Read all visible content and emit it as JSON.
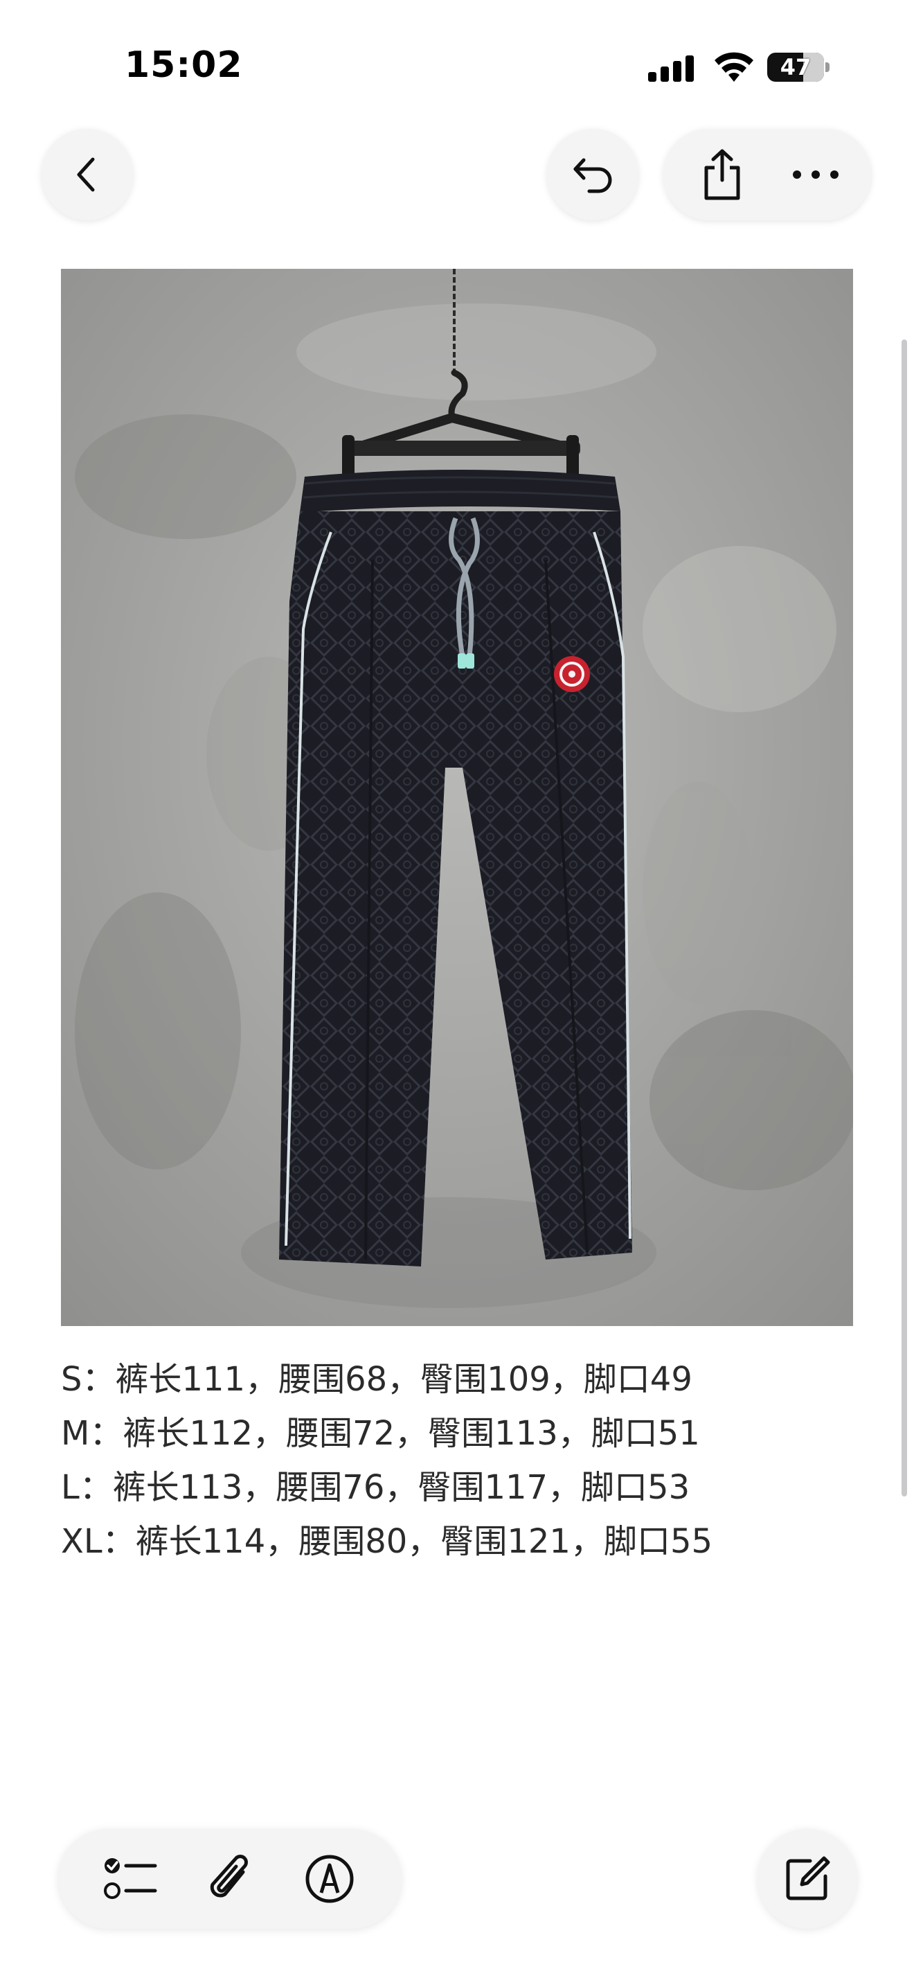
{
  "status_bar": {
    "time": "15:02",
    "battery": "47"
  },
  "nav": {
    "back_icon": "chevron-left-icon",
    "undo_icon": "undo-icon",
    "share_icon": "share-icon",
    "more_icon": "ellipsis-icon"
  },
  "note": {
    "image": "photo of dark patterned track pants hanging on a concrete wall",
    "size_lines": [
      "S：裤长111，腰围68，臀围109，脚口49",
      "M：裤长112，腰围72，臀围113，脚口51",
      "L：裤长113，腰围76，臀围117，脚口53",
      "XL：裤长114，腰围80，臀围121，脚口55"
    ]
  },
  "toolbar": {
    "checklist_icon": "checklist-icon",
    "attach_icon": "paperclip-icon",
    "markup_icon": "pen-circle-icon",
    "compose_icon": "compose-icon"
  },
  "colors": {
    "button_bg": "#f4f4f5",
    "text": "#2b2b2b"
  }
}
